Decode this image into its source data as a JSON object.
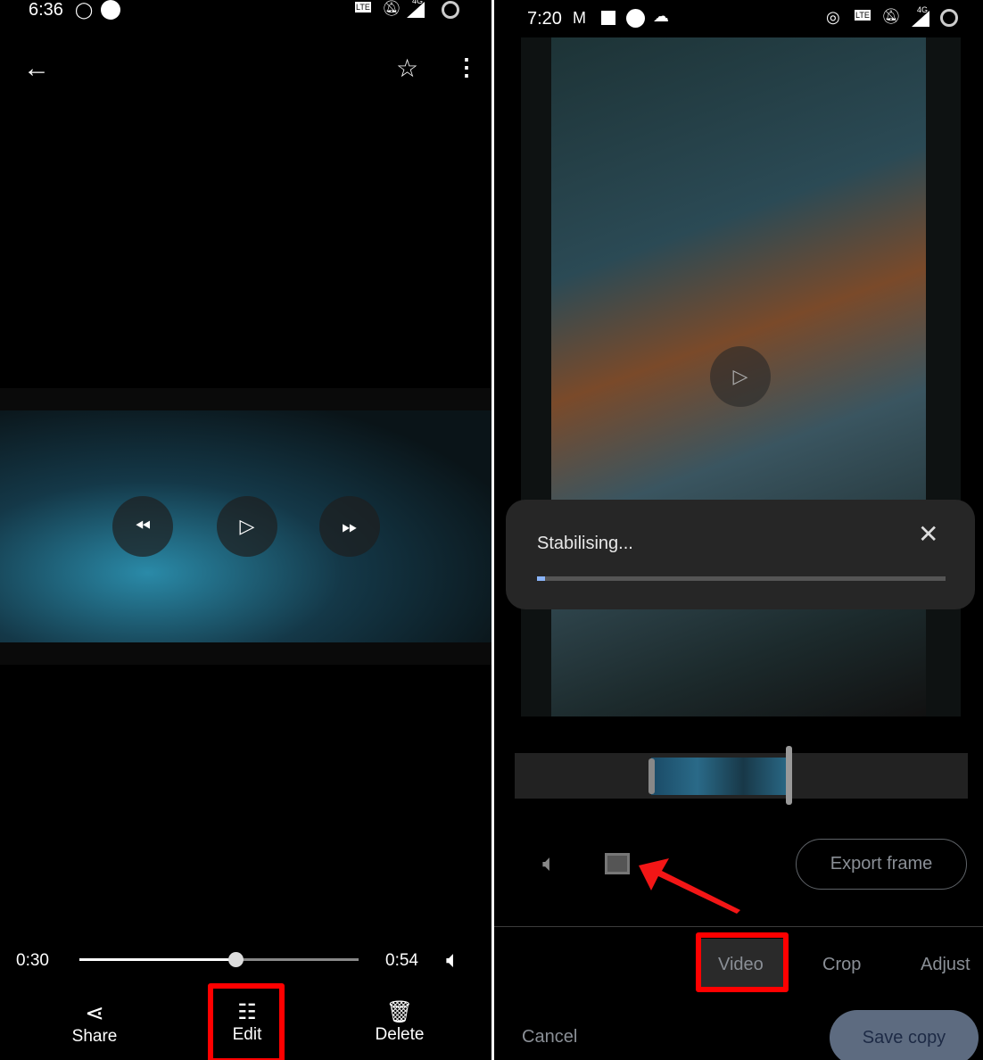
{
  "left": {
    "status": {
      "time": "6:36",
      "icons": [
        "whatsapp-icon",
        "phone-icon",
        "volte-icon",
        "bell-off-icon",
        "4g-signal-icon",
        "battery-icon"
      ],
      "net": "4G"
    },
    "toolbar": {
      "icons": [
        "back-arrow-icon",
        "star-icon",
        "more-vert-icon"
      ]
    },
    "player": {
      "current_time": "0:30",
      "duration": "0:54",
      "progress": 0.56
    },
    "actions": [
      {
        "label": "Share",
        "icon": "share-icon"
      },
      {
        "label": "Edit",
        "icon": "tune-icon"
      },
      {
        "label": "Delete",
        "icon": "trash-icon"
      }
    ]
  },
  "right": {
    "status": {
      "time": "7:20",
      "icons": [
        "gmail-icon",
        "image-icon",
        "phone-icon",
        "cloud-icon",
        "hotspot-icon",
        "volte-icon",
        "bell-off-icon",
        "4g-signal-icon",
        "battery-icon"
      ],
      "net": "4G"
    },
    "dialog": {
      "title": "Stabilising...",
      "progress": 0.02
    },
    "export_frame": "Export frame",
    "tabs": [
      "Video",
      "Crop",
      "Adjust"
    ],
    "active_tab": "Video",
    "cancel": "Cancel",
    "save_copy": "Save copy"
  },
  "colors": {
    "highlight": "#ff0000",
    "save_button": "#5d6b80",
    "save_text": "#1d2a45"
  }
}
